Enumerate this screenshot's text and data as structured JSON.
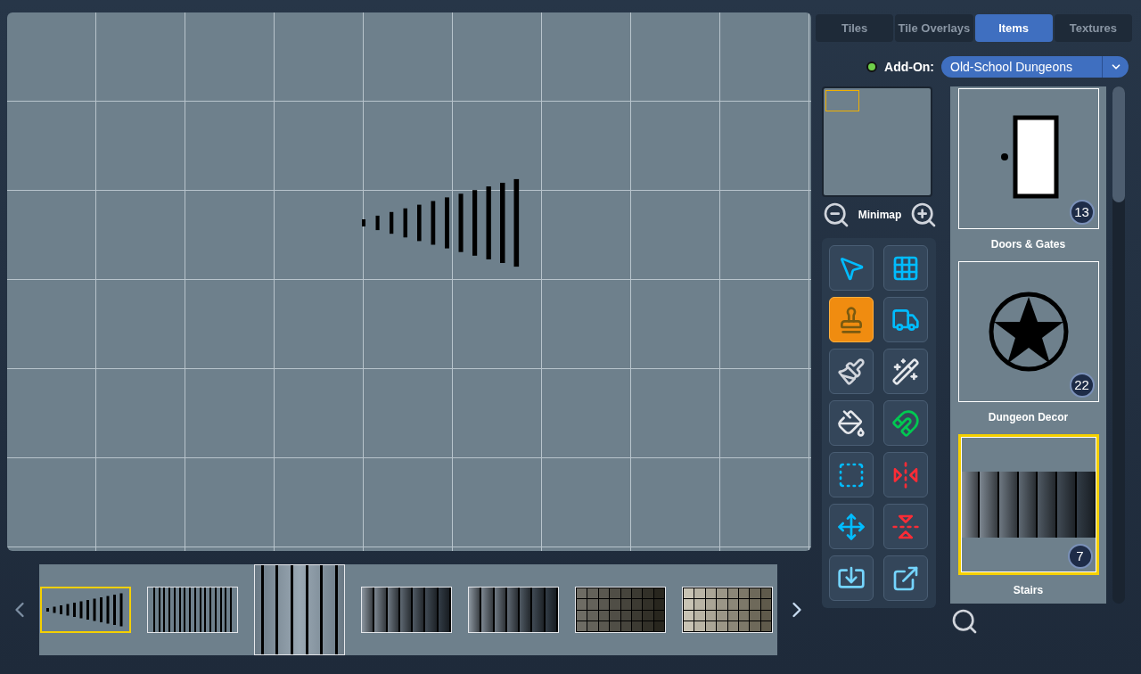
{
  "tabs": [
    {
      "label": "Tiles",
      "selected": false
    },
    {
      "label": "Tile Overlays",
      "selected": false
    },
    {
      "label": "Items",
      "selected": true
    },
    {
      "label": "Textures",
      "selected": false
    }
  ],
  "addon": {
    "enabled": true,
    "label": "Add-On:",
    "value": "Old-School Dungeons"
  },
  "minimap": {
    "label": "Minimap"
  },
  "tools": [
    {
      "kind": "select",
      "selected": false
    },
    {
      "kind": "grid",
      "selected": false
    },
    {
      "kind": "stamp",
      "selected": true
    },
    {
      "kind": "excavator",
      "selected": false
    },
    {
      "kind": "brush",
      "selected": false
    },
    {
      "kind": "wand",
      "selected": false
    },
    {
      "kind": "bucket",
      "selected": false
    },
    {
      "kind": "snap",
      "selected": false
    },
    {
      "kind": "marquee",
      "selected": false
    },
    {
      "kind": "flip-h",
      "selected": false
    },
    {
      "kind": "move",
      "selected": false
    },
    {
      "kind": "flip-v",
      "selected": false
    },
    {
      "kind": "import",
      "selected": false
    },
    {
      "kind": "export",
      "selected": false
    }
  ],
  "categories": [
    {
      "kind": "door",
      "badge": "13",
      "label": "Doors & Gates",
      "selected": false
    },
    {
      "kind": "star",
      "badge": "22",
      "label": "Dungeon Decor",
      "selected": false
    },
    {
      "kind": "stairs",
      "badge": "7",
      "label": "Stairs",
      "selected": true
    }
  ],
  "thumbnails": [
    {
      "kind": "wedge",
      "selected": true
    },
    {
      "kind": "lines",
      "selected": false
    },
    {
      "kind": "tall",
      "selected": false
    },
    {
      "kind": "dark",
      "selected": false
    },
    {
      "kind": "dark",
      "selected": false
    },
    {
      "kind": "stone",
      "selected": false
    },
    {
      "kind": "stone-light",
      "selected": false
    }
  ]
}
